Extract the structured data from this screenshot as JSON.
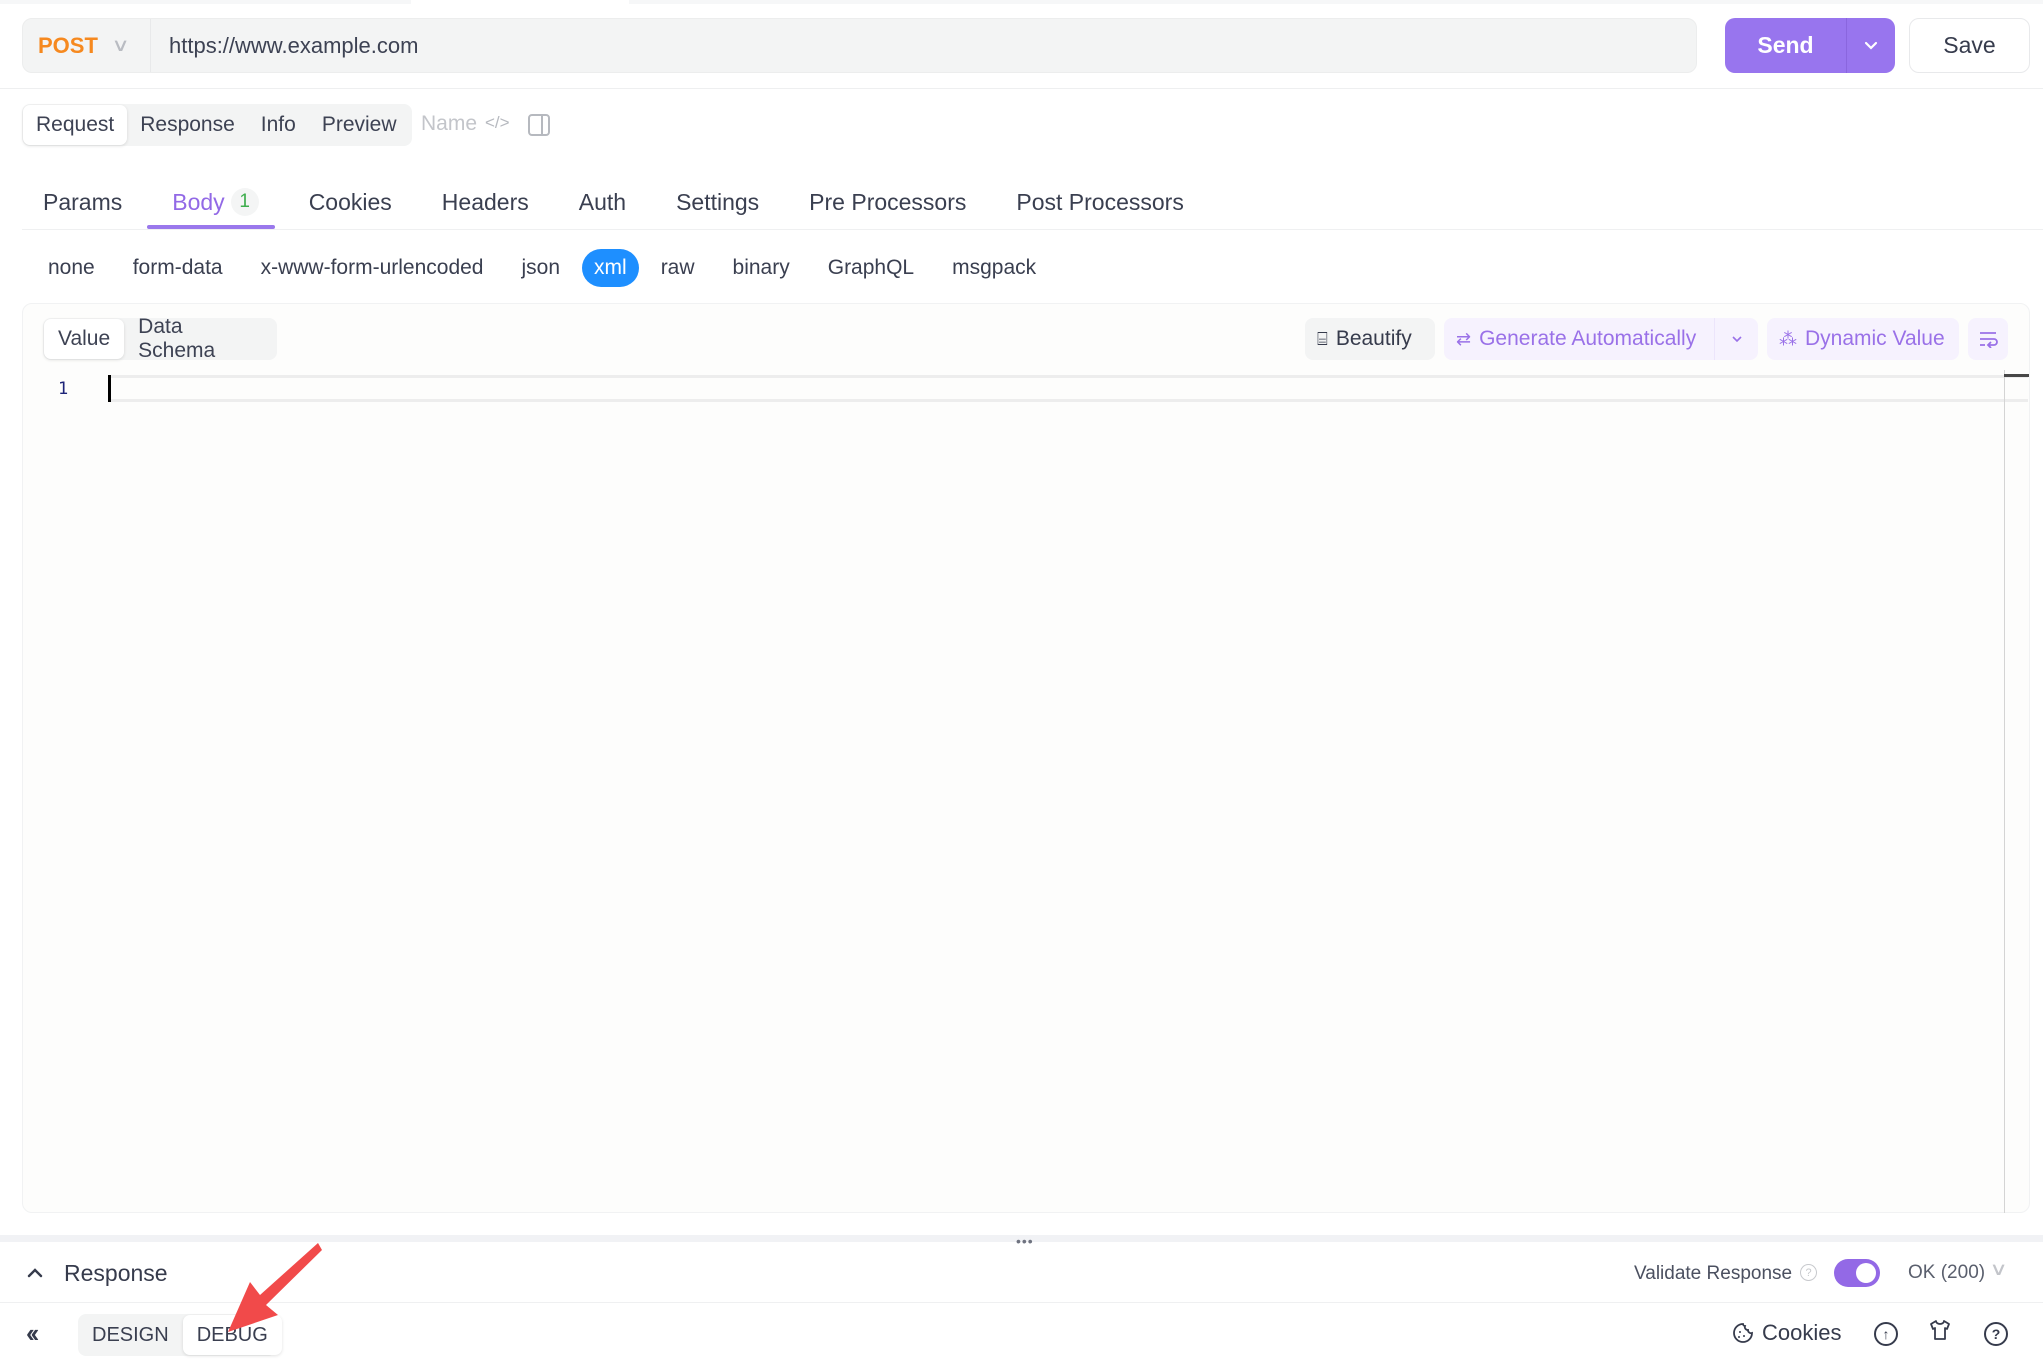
{
  "request": {
    "method": "POST",
    "url": "https://www.example.com",
    "send_label": "Send",
    "save_label": "Save"
  },
  "view_tabs": {
    "items": [
      "Request",
      "Response",
      "Info",
      "Preview"
    ],
    "active": "Request",
    "name_placeholder": "Name"
  },
  "tabs": {
    "items": [
      {
        "label": "Params"
      },
      {
        "label": "Body",
        "badge": "1"
      },
      {
        "label": "Cookies"
      },
      {
        "label": "Headers"
      },
      {
        "label": "Auth"
      },
      {
        "label": "Settings"
      },
      {
        "label": "Pre Processors"
      },
      {
        "label": "Post Processors"
      }
    ],
    "active": "Body"
  },
  "body_types": {
    "items": [
      "none",
      "form-data",
      "x-www-form-urlencoded",
      "json",
      "xml",
      "raw",
      "binary",
      "GraphQL",
      "msgpack"
    ],
    "active": "xml"
  },
  "editor": {
    "mode_tabs": [
      "Value",
      "Data Schema"
    ],
    "active_mode": "Value",
    "actions": {
      "beautify": "Beautify",
      "generate": "Generate Automatically",
      "dynamic": "Dynamic Value"
    },
    "line_numbers": [
      "1"
    ],
    "content": ""
  },
  "response": {
    "title": "Response",
    "validate_label": "Validate Response",
    "validate_enabled": true,
    "status": "OK (200)"
  },
  "footer": {
    "modes": [
      "DESIGN",
      "DEBUG"
    ],
    "active_mode": "DEBUG",
    "cookies_label": "Cookies"
  },
  "colors": {
    "accent": "#9875ee",
    "method": "#f6891f",
    "active_body_type": "#1e8fff",
    "badge": "#3fae4e",
    "annotation_arrow": "#f14a4a"
  }
}
